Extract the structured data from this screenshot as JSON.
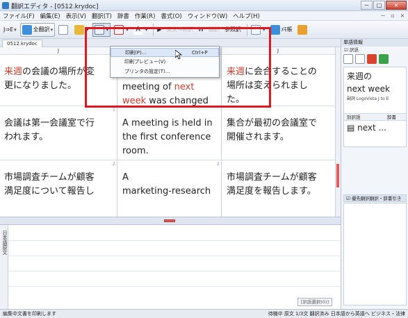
{
  "window": {
    "title": "翻訳エディタ - [0512.krydoc]",
    "controls": [
      "－",
      "□",
      "×"
    ]
  },
  "menubar": {
    "items": [
      "ファイル(F)",
      "編集(E)",
      "表示(V)",
      "翻訳(T)",
      "辞書",
      "作業(R)",
      "書式(O)",
      "ウィンドウ(W)",
      "ヘルプ(H)"
    ],
    "mdi_controls": [
      "－",
      "▫",
      "×"
    ]
  },
  "toolbar": {
    "translate_label": "J⇒E",
    "all_button_label": "全翻訳",
    "start_button": "▶",
    "jp_en_label": "英文⇒和訳",
    "w_label": "W",
    "translation_label": "翻訳",
    "ref_label": "参照訳",
    "ctw_label": "ﾒﾓ帳"
  },
  "doc_tab": {
    "label": "0512.krydoc"
  },
  "column_headers": [
    "J",
    "",
    "J"
  ],
  "rows": [
    {
      "num": "1",
      "source": [
        "来週",
        "の会議の場所が変",
        "更になりました。"
      ],
      "translation": [
        "meeting of ",
        "next",
        " ",
        "week",
        " was changed"
      ],
      "back": [
        "来週",
        "に会合することの",
        "場所は変えられまし",
        "た。"
      ]
    },
    {
      "num": "1",
      "source_lines": [
        "会議は第一会議室で行",
        "われます。"
      ],
      "translation_lines": [
        "A meeting is held in",
        "the first conference",
        "room."
      ],
      "back_lines": [
        "集合が最初の会議室で",
        "開催されます。"
      ]
    },
    {
      "num": "2",
      "source_lines": [
        "市場調査チームが顧客",
        "満足度について報告し"
      ],
      "translation_lines": [
        "A",
        "marketing-research"
      ],
      "back_lines": [
        "市場調査チームが顧客",
        "満足度を報告します。"
      ]
    }
  ],
  "dropdown": {
    "items": [
      {
        "label": "印刷(P)...",
        "shortcut": "Ctrl+P"
      },
      {
        "label": "印刷プレビュー(V)",
        "shortcut": ""
      },
      {
        "label": "プリンタの設定(T)...",
        "shortcut": ""
      }
    ]
  },
  "bottom_pane": {
    "side_label": "日本語原文",
    "button_label": "[訳語選択(0)]"
  },
  "right_panel": {
    "title": "単語情報",
    "sub": "☑ 訳語",
    "word_ja": "来週の",
    "word_en": "next week",
    "meta": "副詞  LogoVista J to E",
    "col1": "別訳語",
    "col2": "辞書",
    "result": "▤ next ...",
    "tab2": "☑ 優先翻訳翻訳・辞書引き"
  },
  "statusbar": {
    "left": "編集中文書を印刷します",
    "right": "待機中  原文  1/3文  翻訳済み  日本語から英語へ  ビジネス・法律"
  },
  "colors": {
    "accent": "#e0171f",
    "highlight_word": "#d23c2c"
  }
}
